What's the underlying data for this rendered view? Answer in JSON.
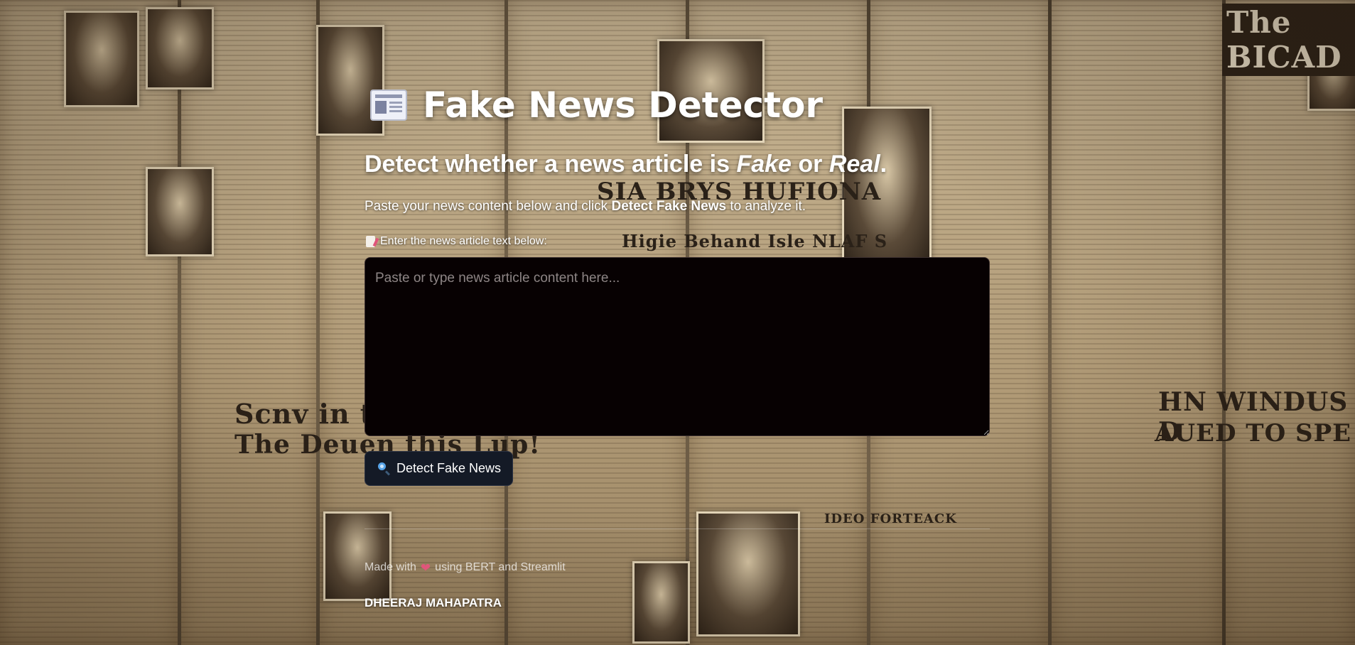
{
  "header": {
    "icon": "newspaper-icon",
    "title": "Fake News Detector"
  },
  "subtitle": {
    "before": "Detect whether a news article is ",
    "fake": "Fake",
    "middle": " or ",
    "real": "Real",
    "after": "."
  },
  "instructions": {
    "before": "Paste your news content below and click ",
    "button_ref": "Detect Fake News",
    "after": " to analyze it."
  },
  "input": {
    "icon": "memo-icon",
    "label": "Enter the news article text below:",
    "value": "",
    "placeholder": "Paste or type news article content here..."
  },
  "detect_button": {
    "icon": "magnifier-icon",
    "label": "Detect Fake News"
  },
  "footer": {
    "made_with": "Made with",
    "heart_icon": "heart-icon",
    "using": "using BERT and Streamlit",
    "author": "DHEERAJ MAHAPATRA"
  },
  "colors": {
    "textarea_bg": "#070102",
    "button_bg": "#141a26",
    "heart": "#e0557a",
    "text": "#ffffff"
  }
}
